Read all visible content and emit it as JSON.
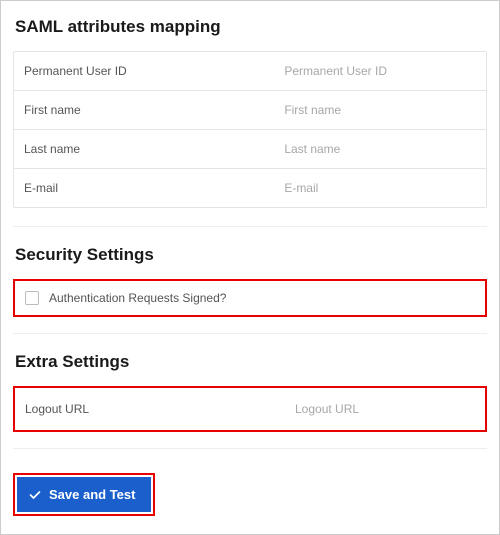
{
  "sections": {
    "mapping": {
      "title": "SAML attributes mapping",
      "rows": [
        {
          "label": "Permanent User ID",
          "placeholder": "Permanent User ID"
        },
        {
          "label": "First name",
          "placeholder": "First name"
        },
        {
          "label": "Last name",
          "placeholder": "Last name"
        },
        {
          "label": "E-mail",
          "placeholder": "E-mail"
        }
      ]
    },
    "security": {
      "title": "Security Settings",
      "checkbox_label": "Authentication Requests Signed?"
    },
    "extra": {
      "title": "Extra Settings",
      "logout_label": "Logout URL",
      "logout_placeholder": "Logout URL"
    }
  },
  "buttons": {
    "save_label": "Save and Test"
  }
}
